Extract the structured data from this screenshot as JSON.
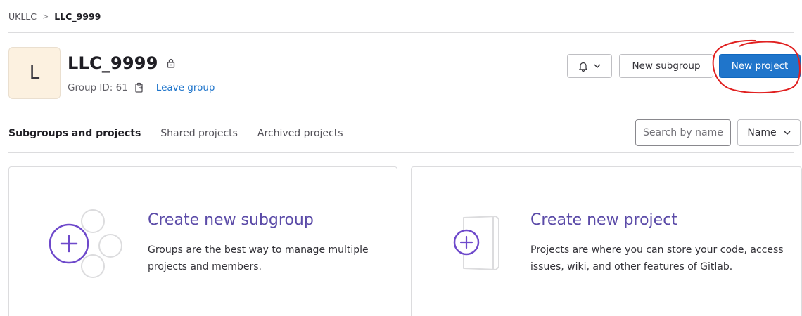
{
  "breadcrumb": {
    "root": "UKLLC",
    "separator": ">",
    "current": "LLC_9999"
  },
  "group": {
    "avatar_letter": "L",
    "name": "LLC_9999",
    "id_label": "Group ID: 61",
    "leave_label": "Leave group"
  },
  "header_actions": {
    "notification_icon": "bell-icon",
    "new_subgroup": "New subgroup",
    "new_project": "New project"
  },
  "tabs": [
    {
      "label": "Subgroups and projects",
      "active": true
    },
    {
      "label": "Shared projects",
      "active": false
    },
    {
      "label": "Archived projects",
      "active": false
    }
  ],
  "search": {
    "placeholder": "Search by name"
  },
  "sort": {
    "label": "Name"
  },
  "cards": {
    "subgroup": {
      "title": "Create new subgroup",
      "description": "Groups are the best way to manage multiple projects and members."
    },
    "project": {
      "title": "Create new project",
      "description": "Projects are where you can store your code, access issues, wiki, and other features of Gitlab."
    }
  },
  "colors": {
    "primary": "#1f75cb",
    "accent_purple": "#6e49cb",
    "annotation_red": "#e02020"
  }
}
